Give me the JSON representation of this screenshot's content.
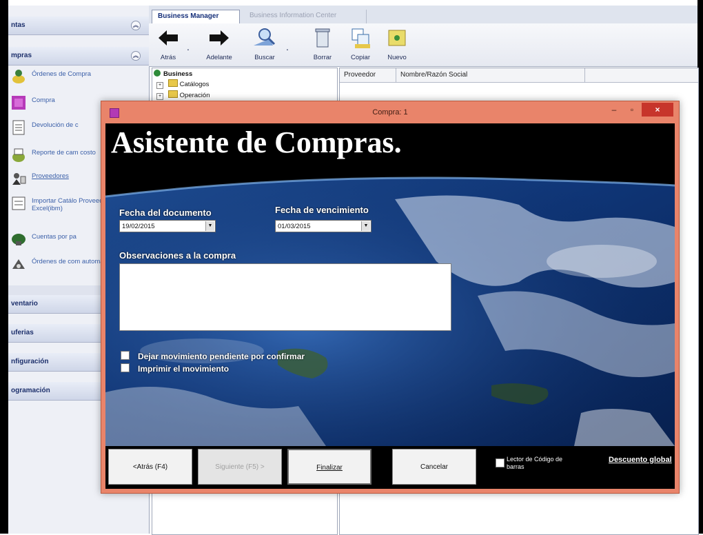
{
  "sidebar": {
    "sections": [
      {
        "label": "ntas"
      },
      {
        "label": "mpras"
      }
    ],
    "items": [
      {
        "label": "Órdenes de Compra"
      },
      {
        "label": "Compra"
      },
      {
        "label": "Devolución de c"
      },
      {
        "label": "Reporte de cam costo"
      },
      {
        "label": "Proveedores"
      },
      {
        "label": "Importar Catálo Proveedores de Excel(ibm)"
      },
      {
        "label": "Cuentas por pa"
      },
      {
        "label": "Órdenes de com automáticas"
      }
    ],
    "bottom_sections": [
      {
        "label": "ventario"
      },
      {
        "label": "uferias"
      },
      {
        "label": "nfiguración"
      },
      {
        "label": "ogramación"
      }
    ]
  },
  "tabs": [
    {
      "label": "Business Manager"
    },
    {
      "label": "Business Information Center"
    }
  ],
  "toolbar": {
    "back": "Atrás",
    "forward": "Adelante",
    "search": "Buscar",
    "delete": "Borrar",
    "copy": "Copiar",
    "new": "Nuevo"
  },
  "tree": {
    "root": "Business",
    "children": [
      "Catálogos",
      "Operación"
    ]
  },
  "list": {
    "columns": [
      "Proveedor",
      "Nombre/Razón Social"
    ]
  },
  "dialog": {
    "title": "Compra: 1",
    "heading": "Asistente de Compras.",
    "doc_date_label": "Fecha del documento",
    "doc_date_value": "19/02/2015",
    "due_date_label": "Fecha de vencimiento",
    "due_date_value": "01/03/2015",
    "observations_label": "Observaciones a la compra",
    "observations_value": "",
    "pending_label": "Dejar movimiento pendiente por confirmar",
    "print_label": "Imprimir el movimiento",
    "buttons": {
      "back": "<Atrás (F4)",
      "next": "Siguiente (F5) >",
      "finish": "Finalizar",
      "cancel": "Cancelar"
    },
    "barcode_label": "Lector de Código de barras",
    "discount_label": "Descuento global"
  },
  "colors": {
    "window_frame": "#e9846a",
    "close_button": "#c7352b"
  }
}
